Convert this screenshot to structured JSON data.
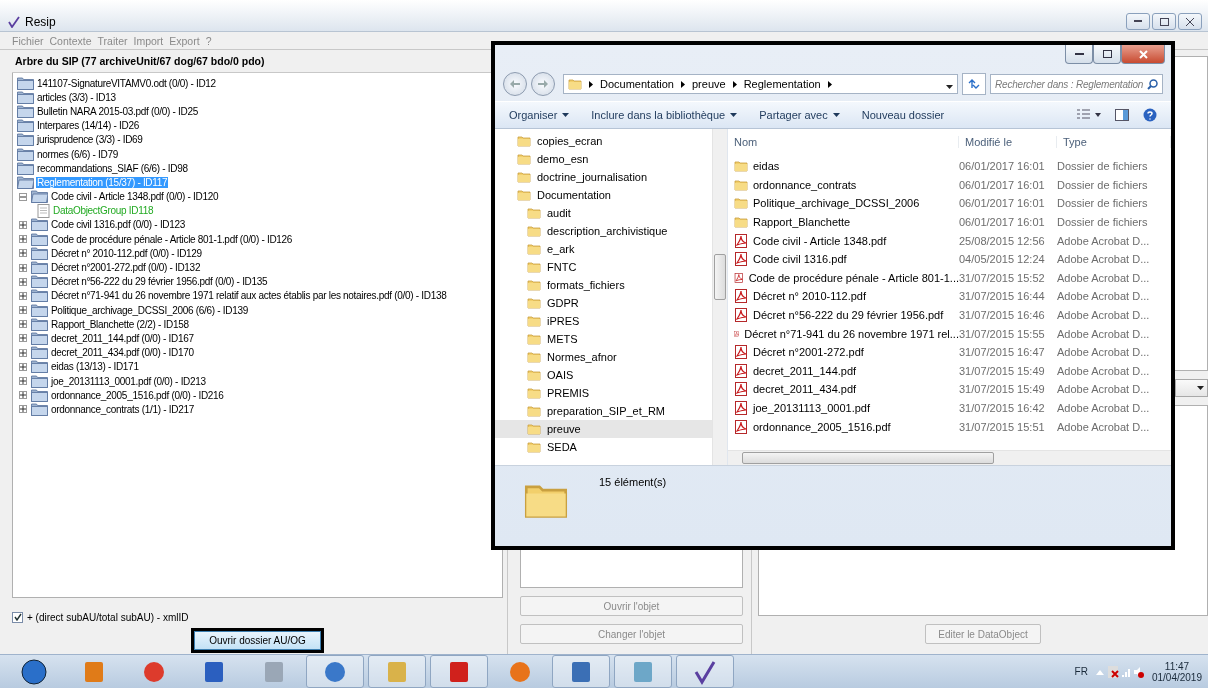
{
  "window": {
    "title": "Resip"
  },
  "menu": [
    "Fichier",
    "Contexte",
    "Traiter",
    "Import",
    "Export",
    "?"
  ],
  "tree": {
    "title": "Arbre du SIP (77 archiveUnit/67 dog/67 bdo/0 pdo)",
    "items": [
      {
        "label": "141107-SignatureVITAMV0.odt (0/0) - ID12",
        "kind": "unit",
        "selected": false
      },
      {
        "label": "articles (3/3) - ID13",
        "kind": "unit",
        "selected": false
      },
      {
        "label": "Bulletin NARA 2015-03.pdf (0/0) - ID25",
        "kind": "unit",
        "selected": false
      },
      {
        "label": "Interpares (14/14) - ID26",
        "kind": "unit",
        "selected": false
      },
      {
        "label": "jurisprudence (3/3) - ID69",
        "kind": "unit",
        "selected": false
      },
      {
        "label": "normes (6/6) - ID79",
        "kind": "unit",
        "selected": false
      },
      {
        "label": "recommandations_SIAF (6/6) - ID98",
        "kind": "unit",
        "selected": false
      },
      {
        "label": "Reglementation (15/37) - ID117",
        "kind": "unit",
        "selected": true,
        "children": [
          {
            "label": "Code civil - Article 1348.pdf (0/0) - ID120",
            "kind": "unit",
            "selected": false,
            "expanded": true,
            "children": [
              {
                "label": "DataObjectGroup ID118",
                "kind": "object",
                "selected": false
              }
            ]
          },
          {
            "label": "Code civil 1316.pdf (0/0) - ID123",
            "kind": "unit",
            "selected": false,
            "expanded": false
          },
          {
            "label": "Code de procédure pénale - Article 801-1.pdf (0/0) - ID126",
            "kind": "unit",
            "selected": false,
            "expanded": false
          },
          {
            "label": "Décret n° 2010-112.pdf (0/0) - ID129",
            "kind": "unit",
            "selected": false,
            "expanded": false
          },
          {
            "label": "Décret n°2001-272.pdf (0/0) - ID132",
            "kind": "unit",
            "selected": false,
            "expanded": false
          },
          {
            "label": "Décret n°56-222 du 29 février 1956.pdf (0/0) - ID135",
            "kind": "unit",
            "selected": false,
            "expanded": false
          },
          {
            "label": "Décret n°71-941 du 26 novembre 1971 relatif aux actes établis par les notaires.pdf (0/0) - ID138",
            "kind": "unit",
            "selected": false,
            "expanded": false
          },
          {
            "label": "Politique_archivage_DCSSI_2006 (6/6) - ID139",
            "kind": "unit",
            "selected": false,
            "expanded": false
          },
          {
            "label": "Rapport_Blanchette (2/2) - ID158",
            "kind": "unit",
            "selected": false,
            "expanded": false
          },
          {
            "label": "decret_2011_144.pdf (0/0) - ID167",
            "kind": "unit",
            "selected": false,
            "expanded": false
          },
          {
            "label": "decret_2011_434.pdf (0/0) - ID170",
            "kind": "unit",
            "selected": false,
            "expanded": false
          },
          {
            "label": "eidas (13/13) - ID171",
            "kind": "unit",
            "selected": false,
            "expanded": false
          },
          {
            "label": "joe_20131113_0001.pdf (0/0) - ID213",
            "kind": "unit",
            "selected": false,
            "expanded": false
          },
          {
            "label": "ordonnance_2005_1516.pdf (0/0) - ID216",
            "kind": "unit",
            "selected": false,
            "expanded": false
          },
          {
            "label": "ordonnance_contrats (1/1) - ID217",
            "kind": "unit",
            "selected": false,
            "expanded": false
          }
        ]
      }
    ]
  },
  "tree_options": {
    "checkbox": {
      "label": "+ (direct subAU/total subAU) - xmlID",
      "checked": true
    },
    "button": "Ouvrir dossier AU/OG"
  },
  "object_panel": {
    "buttons": [
      "Ouvrir l'objet",
      "Changer l'objet"
    ]
  },
  "data_panel": {
    "button": "Editer le DataObject"
  },
  "explorer": {
    "breadcrumb": [
      "Documentation",
      "preuve",
      "Reglementation"
    ],
    "search": {
      "placeholder": "Rechercher dans : Reglementation"
    },
    "toolbar": [
      {
        "label": "Organiser",
        "dropdown": true
      },
      {
        "label": "Inclure dans la bibliothèque",
        "dropdown": true
      },
      {
        "label": "Partager avec",
        "dropdown": true
      },
      {
        "label": "Nouveau dossier",
        "dropdown": false
      }
    ],
    "nav": [
      {
        "label": "copies_ecran",
        "selected": false
      },
      {
        "label": "demo_esn",
        "selected": false
      },
      {
        "label": "doctrine_journalisation",
        "selected": false
      },
      {
        "label": "Documentation",
        "selected": false,
        "children": [
          {
            "label": "audit",
            "selected": false
          },
          {
            "label": "description_archivistique",
            "selected": false
          },
          {
            "label": "e_ark",
            "selected": false
          },
          {
            "label": "FNTC",
            "selected": false
          },
          {
            "label": "formats_fichiers",
            "selected": false
          },
          {
            "label": "GDPR",
            "selected": false
          },
          {
            "label": "iPRES",
            "selected": false
          },
          {
            "label": "METS",
            "selected": false
          },
          {
            "label": "Normes_afnor",
            "selected": false
          },
          {
            "label": "OAIS",
            "selected": false
          },
          {
            "label": "PREMIS",
            "selected": false
          },
          {
            "label": "preparation_SIP_et_RM",
            "selected": false
          },
          {
            "label": "preuve",
            "selected": true
          },
          {
            "label": "SEDA",
            "selected": false
          }
        ]
      }
    ],
    "columns": [
      "Nom",
      "Modifié le",
      "Type"
    ],
    "files": [
      {
        "kind": "folder",
        "name": "eidas",
        "modified": "06/01/2017 16:01",
        "type": "Dossier de fichiers"
      },
      {
        "kind": "folder",
        "name": "ordonnance_contrats",
        "modified": "06/01/2017 16:01",
        "type": "Dossier de fichiers"
      },
      {
        "kind": "folder",
        "name": "Politique_archivage_DCSSI_2006",
        "modified": "06/01/2017 16:01",
        "type": "Dossier de fichiers"
      },
      {
        "kind": "folder",
        "name": "Rapport_Blanchette",
        "modified": "06/01/2017 16:01",
        "type": "Dossier de fichiers"
      },
      {
        "kind": "pdf",
        "name": "Code civil - Article 1348.pdf",
        "modified": "25/08/2015 12:56",
        "type": "Adobe Acrobat D..."
      },
      {
        "kind": "pdf",
        "name": "Code civil 1316.pdf",
        "modified": "04/05/2015 12:24",
        "type": "Adobe Acrobat D..."
      },
      {
        "kind": "pdf",
        "name": "Code de procédure pénale - Article 801-1...",
        "modified": "31/07/2015 15:52",
        "type": "Adobe Acrobat D..."
      },
      {
        "kind": "pdf",
        "name": "Décret n° 2010-112.pdf",
        "modified": "31/07/2015 16:44",
        "type": "Adobe Acrobat D..."
      },
      {
        "kind": "pdf",
        "name": "Décret n°56-222 du 29 février 1956.pdf",
        "modified": "31/07/2015 16:46",
        "type": "Adobe Acrobat D..."
      },
      {
        "kind": "pdf",
        "name": "Décret n°71-941 du 26 novembre 1971 rel...",
        "modified": "31/07/2015 15:55",
        "type": "Adobe Acrobat D..."
      },
      {
        "kind": "pdf",
        "name": "Décret n°2001-272.pdf",
        "modified": "31/07/2015 16:47",
        "type": "Adobe Acrobat D..."
      },
      {
        "kind": "pdf",
        "name": "decret_2011_144.pdf",
        "modified": "31/07/2015 15:49",
        "type": "Adobe Acrobat D..."
      },
      {
        "kind": "pdf",
        "name": "decret_2011_434.pdf",
        "modified": "31/07/2015 15:49",
        "type": "Adobe Acrobat D..."
      },
      {
        "kind": "pdf",
        "name": "joe_20131113_0001.pdf",
        "modified": "31/07/2015 16:42",
        "type": "Adobe Acrobat D..."
      },
      {
        "kind": "pdf",
        "name": "ordonnance_2005_1516.pdf",
        "modified": "31/07/2015 15:51",
        "type": "Adobe Acrobat D..."
      }
    ],
    "status": "15 élément(s)"
  },
  "taskbar": {
    "language": "FR",
    "time": "11:47",
    "date": "01/04/2019"
  }
}
